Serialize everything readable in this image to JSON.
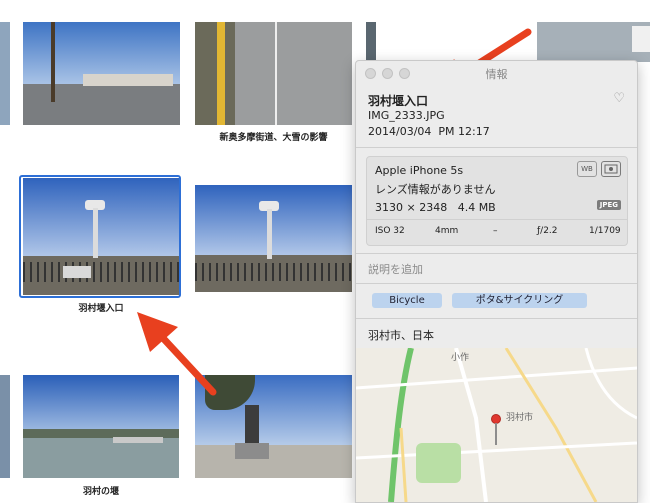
{
  "captions": {
    "top_center": "新奥多摩街道、大雪の影響",
    "selected": "羽村堰入口",
    "bottom_left": "羽村の堰"
  },
  "info_panel": {
    "window_title": "情報",
    "photo_title": "羽村堰入口",
    "filename": "IMG_2333.JPG",
    "date": "2014/03/04",
    "time": "PM 12:17",
    "camera_model": "Apple iPhone 5s",
    "lens_info": "レンズ情報がありません",
    "dimensions": "3130 × 2348",
    "file_size": "4.4 MB",
    "format_badge": "JPEG",
    "wb_icon_label": "WB",
    "exif": {
      "iso": "ISO 32",
      "focal_length": "4mm",
      "exposure_bias": "–",
      "aperture": "ƒ/2.2",
      "shutter": "1/1709"
    },
    "description_placeholder": "説明を追加",
    "keywords": [
      "Bicycle",
      "ポタ&サイクリング"
    ],
    "location": "羽村市、日本"
  },
  "map": {
    "label_town": "小作",
    "label_city": "羽村市"
  },
  "colors": {
    "selection_border": "#2d6fd6",
    "tag_bg": "#bcd3ee",
    "pin": "#e0382f",
    "annotation_arrow": "#e8401f"
  }
}
